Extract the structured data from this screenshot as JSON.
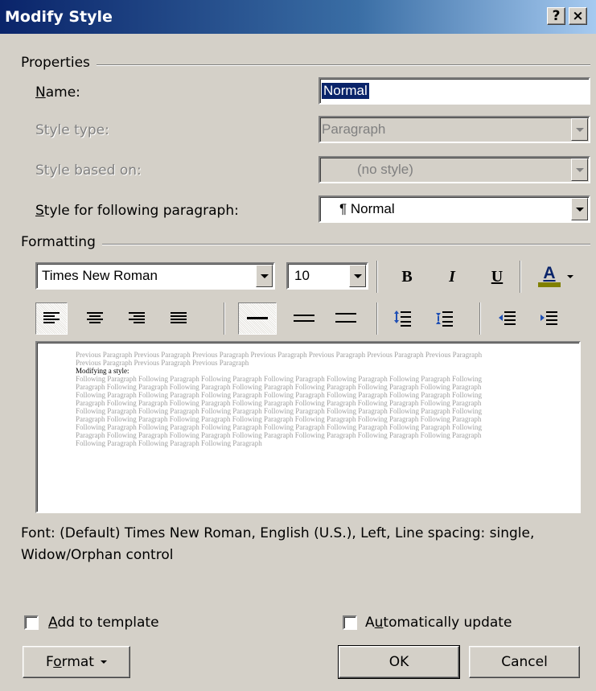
{
  "window": {
    "title": "Modify Style",
    "help_label": "?",
    "close_label": "×"
  },
  "properties": {
    "group_label": "Properties",
    "name_label": "Name:",
    "name_value": "Normal",
    "style_type_label": "Style type:",
    "style_type_value": "Paragraph",
    "based_on_label": "Style based on:",
    "based_on_value": "(no style)",
    "following_label": "Style for following paragraph:",
    "following_value": "¶ Normal"
  },
  "formatting": {
    "group_label": "Formatting",
    "font_name": "Times New Roman",
    "font_size": "10",
    "bold_label": "B",
    "italic_label": "I",
    "underline_label": "U",
    "font_color_label": "A",
    "font_color_swatch": "#808000",
    "alignment_selected": "left",
    "line_spacing_selected": "single"
  },
  "preview": {
    "previous_text": "Previous Paragraph Previous Paragraph Previous Paragraph Previous Paragraph Previous Paragraph Previous Paragraph Previous Paragraph Previous Paragraph Previous Paragraph Previous Paragraph",
    "modifying_text": "Modifying a style:",
    "following_text": "Following Paragraph Following Paragraph Following Paragraph Following Paragraph Following Paragraph Following Paragraph Following Paragraph Following Paragraph Following Paragraph Following Paragraph Following Paragraph Following Paragraph Following Paragraph Following Paragraph Following Paragraph Following Paragraph Following Paragraph Following Paragraph Following Paragraph Following Paragraph Following Paragraph Following Paragraph Following Paragraph Following Paragraph Following Paragraph Following Paragraph Following Paragraph Following Paragraph Following Paragraph Following Paragraph Following Paragraph Following Paragraph Following Paragraph Following Paragraph Following Paragraph Following Paragraph Following Paragraph Following Paragraph Following Paragraph Following Paragraph Following Paragraph Following Paragraph Following Paragraph Following Paragraph Following Paragraph Following Paragraph Following Paragraph Following Paragraph Following Paragraph Following Paragraph Following Paragraph Following Paragraph Following Paragraph Following Paragraph Following Paragraph"
  },
  "description": "Font: (Default) Times New Roman, English (U.S.), Left, Line spacing: single, Widow/Orphan control",
  "options": {
    "add_to_template_label": "Add to template",
    "add_to_template_checked": false,
    "auto_update_label": "Automatically update",
    "auto_update_checked": false
  },
  "buttons": {
    "format_label": "Format",
    "ok_label": "OK",
    "cancel_label": "Cancel"
  }
}
